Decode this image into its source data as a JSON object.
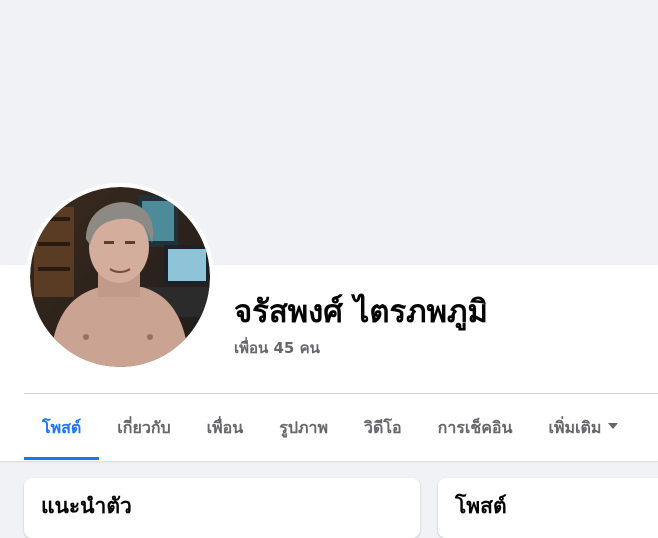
{
  "profile": {
    "name": "จรัสพงศ์ ไตรภพภูมิ",
    "friends": "เพื่อน 45 คน",
    "avatar_icon": "profile-photo"
  },
  "tabs": [
    {
      "label": "โพสต์",
      "active": true
    },
    {
      "label": "เกี่ยวกับ",
      "active": false
    },
    {
      "label": "เพื่อน",
      "active": false
    },
    {
      "label": "รูปภาพ",
      "active": false
    },
    {
      "label": "วิดีโอ",
      "active": false
    },
    {
      "label": "การเช็คอิน",
      "active": false
    },
    {
      "label": "เพิ่มเติม",
      "active": false,
      "icon": "caret-down-icon"
    }
  ],
  "cards": {
    "intro_title": "แนะนำตัว",
    "posts_title": "โพสต์"
  },
  "colors": {
    "accent": "#1877f2",
    "background": "#f0f2f5",
    "text_secondary": "#65676b"
  }
}
